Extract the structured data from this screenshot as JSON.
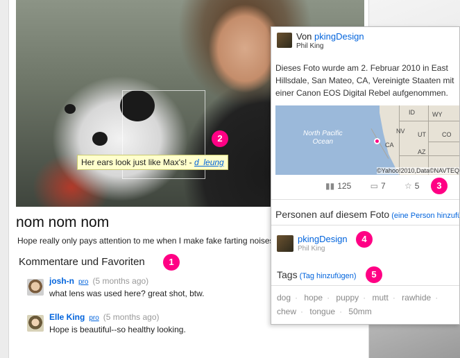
{
  "photo": {
    "note_text": "Her ears look just like Max's! - ",
    "note_author": "d_leung",
    "title": "nom nom nom",
    "description": "Hope really only pays attention to me when I make fake farting noises."
  },
  "comments": {
    "heading": "Kommentare und Favoriten",
    "items": [
      {
        "author": "josh-n",
        "pro": "pro",
        "time": "(5 months ago)",
        "text": "what lens was used here? great shot, btw."
      },
      {
        "author": "Elle King",
        "pro": "pro",
        "time": "(5 months ago)",
        "text": "Hope is beautiful--so healthy looking."
      }
    ]
  },
  "sidebar": {
    "by_prefix": "Von ",
    "owner": "pkingDesign",
    "owner_real_name": "Phil King",
    "taken_text": "Dieses Foto wurde am 2. Februar 2010 in East Hillsdale, San Mateo, CA, Vereinigte Staaten mit einer Canon EOS Digital Rebel aufgenommen.",
    "map": {
      "ocean_line1": "North Pacific",
      "ocean_line2": "Ocean",
      "states": [
        "ID",
        "WY",
        "NV",
        "UT",
        "CO",
        "CA",
        "AZ"
      ],
      "copyright": "©Yahoo!2010,Data©NAVTEQ"
    },
    "stats": {
      "views": "125",
      "comments": "7",
      "favorites": "5"
    },
    "people_heading": "Personen auf diesem Foto",
    "add_person": "(eine Person hinzufügen)",
    "person_name": "pkingDesign",
    "person_real": "Phil King",
    "tags_heading": "Tags",
    "add_tag": "(Tag hinzufügen)",
    "tags": [
      "dog",
      "hope",
      "puppy",
      "mutt",
      "rawhide",
      "chew",
      "tongue",
      "50mm"
    ]
  },
  "badges": [
    "1",
    "2",
    "3",
    "4",
    "5"
  ],
  "colors": {
    "link": "#0063dc",
    "badge": "#ff0084",
    "note_bg": "#ffffcc"
  }
}
